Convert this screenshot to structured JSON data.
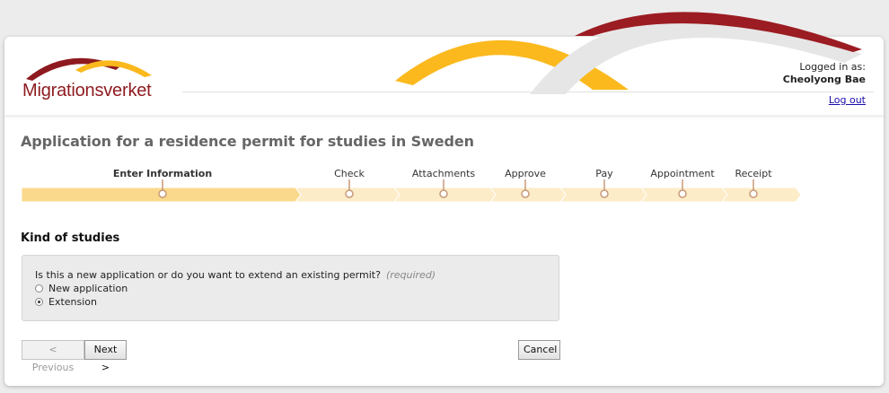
{
  "header": {
    "logo_text": "Migrationsverket",
    "logged_in_label": "Logged in as:",
    "user_name": "Cheolyong Bae",
    "logout_label": "Log out"
  },
  "page_title": "Application for a residence permit for studies in Sweden",
  "steps": [
    {
      "label": "Enter Information",
      "active": true
    },
    {
      "label": "Check",
      "active": false
    },
    {
      "label": "Attachments",
      "active": false
    },
    {
      "label": "Approve",
      "active": false
    },
    {
      "label": "Pay",
      "active": false
    },
    {
      "label": "Appointment",
      "active": false
    },
    {
      "label": "Receipt",
      "active": false
    }
  ],
  "section": {
    "heading": "Kind of studies",
    "question": "Is this a new application or do you want to extend an existing permit?",
    "required_label": "(required)",
    "options": [
      {
        "label": "New application",
        "checked": false
      },
      {
        "label": "Extension",
        "checked": true
      }
    ]
  },
  "buttons": {
    "previous": "< Previous",
    "next": "Next >",
    "cancel": "Cancel"
  },
  "colors": {
    "brand_red": "#8e1a1f",
    "brand_yellow": "#fbb91d",
    "progress_active": "#fbd98c",
    "progress_inactive": "#fdecc8"
  }
}
